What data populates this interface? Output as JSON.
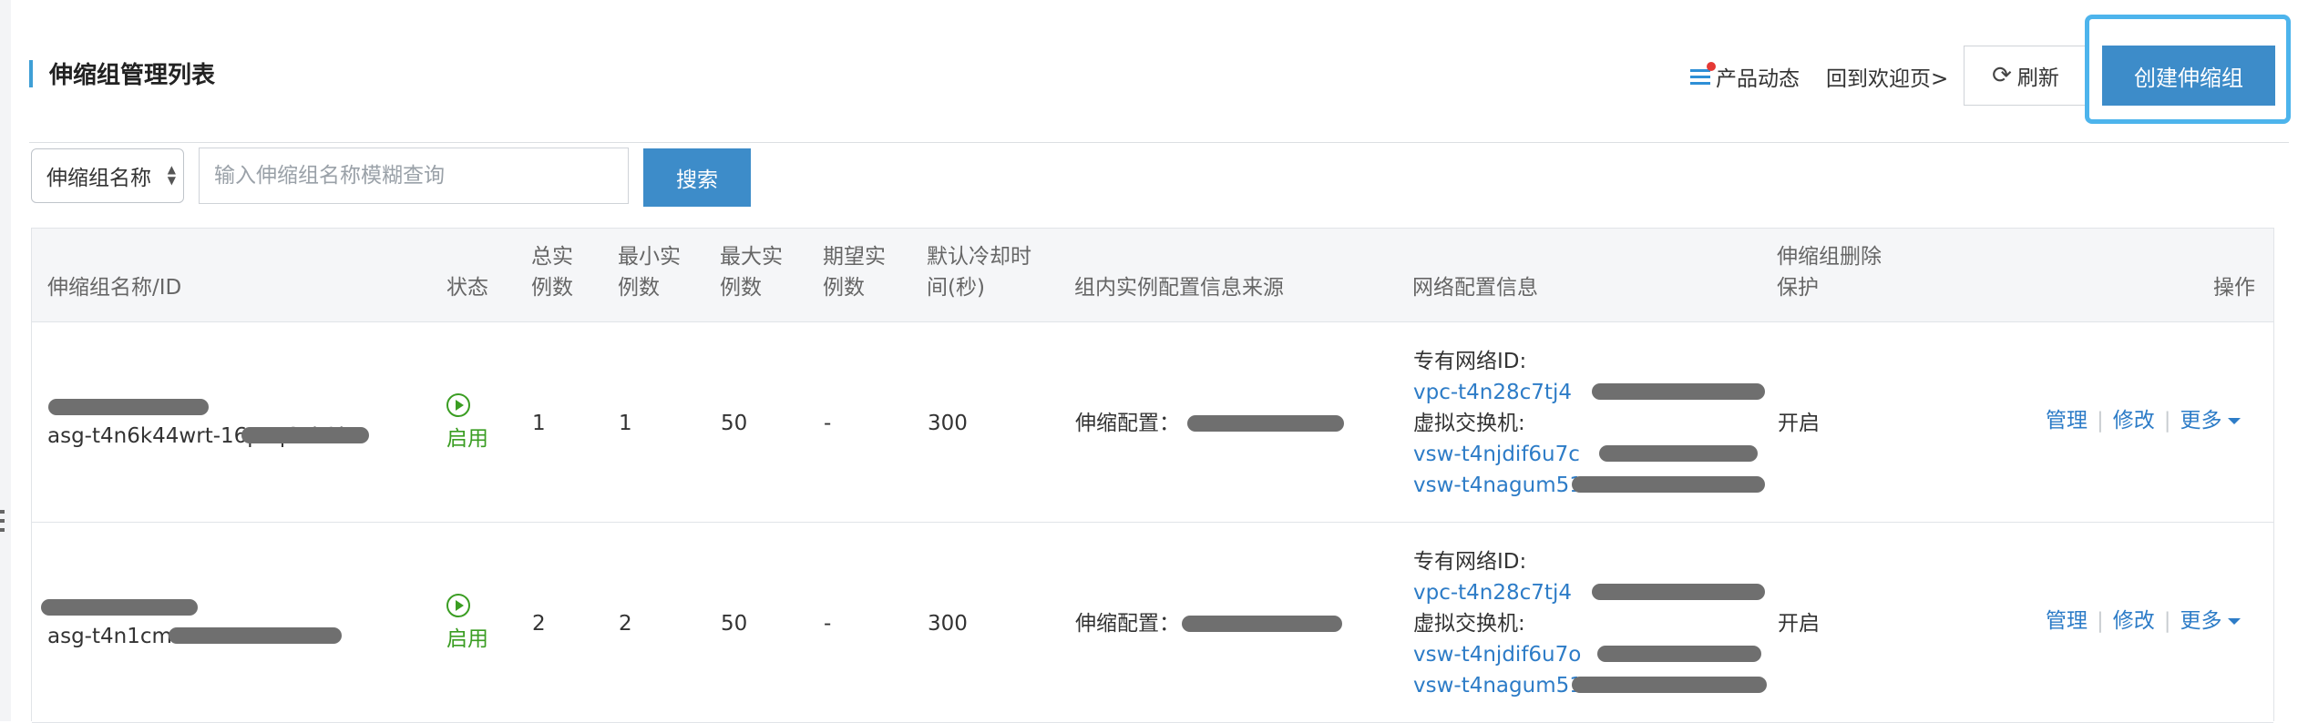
{
  "header": {
    "title": "伸缩组管理列表",
    "news": "产品动态",
    "welcome": "回到欢迎页>",
    "refresh": "刷新",
    "create": "创建伸缩组"
  },
  "search": {
    "select_value": "伸缩组名称",
    "placeholder": "输入伸缩组名称模糊查询",
    "button": "搜索"
  },
  "table": {
    "headers": {
      "name": "伸缩组名称/ID",
      "status": "状态",
      "total_1": "总实",
      "total_2": "例数",
      "min_1": "最小实",
      "min_2": "例数",
      "max_1": "最大实",
      "max_2": "例数",
      "expect_1": "期望实",
      "expect_2": "例数",
      "cooldown_1": "默认冷却时",
      "cooldown_2": "间(秒)",
      "config_source": "组内实例配置信息来源",
      "network": "网络配置信息",
      "protect_1": "伸缩组删除",
      "protect_2": "保护",
      "actions": "操作"
    },
    "rows": [
      {
        "id": "asg-t4n6k44wrt-16pcq64b2b",
        "status": "启用",
        "total": "1",
        "min": "1",
        "max": "50",
        "expected": "-",
        "cooldown": "300",
        "config_label": "伸缩配置：",
        "vpc_label": "专有网络ID:",
        "vpc": "vpc-t4n28c7tj4",
        "vsw_label": "虚拟交换机:",
        "vsw1": "vsw-t4njdif6u7c",
        "vsw2": "vsw-t4nagum51",
        "protect": "开启",
        "manage": "管理",
        "modify": "修改",
        "more": "更多"
      },
      {
        "id": "asg-t4n1cm",
        "status": "启用",
        "total": "2",
        "min": "2",
        "max": "50",
        "expected": "-",
        "cooldown": "300",
        "config_label": "伸缩配置：",
        "vpc_label": "专有网络ID:",
        "vpc": "vpc-t4n28c7tj4",
        "vsw_label": "虚拟交换机:",
        "vsw1": "vsw-t4njdif6u7o",
        "vsw2": "vsw-t4nagum51",
        "protect": "开启",
        "manage": "管理",
        "modify": "修改",
        "more": "更多"
      }
    ]
  },
  "colors": {
    "primary": "#3d8cc9",
    "link": "#2d7cc7",
    "status_green": "#3a9d22",
    "highlight_frame": "#4db4ec"
  }
}
